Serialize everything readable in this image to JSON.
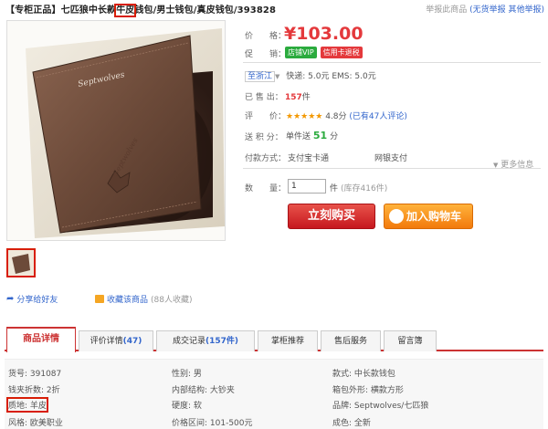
{
  "header": {
    "title_pre": "【专柜正品】七匹狼中长款",
    "title_hl": "牛皮",
    "title_post": "钱包/男士钱包/真皮钱包/393828",
    "report_prefix": "举报此商品",
    "no_fake_report": "(无货举报",
    "other_report": "其他举报)"
  },
  "info": {
    "price_label": "价　　格：",
    "price": "¥103.00",
    "promo_label": "促　　销：",
    "promo_badges": [
      "店铺VIP",
      "信用卡退税"
    ],
    "ship_from": "至浙江",
    "ship_text": "快递: 5.0元  EMS: 5.0元",
    "sold_label": "已 售 出：",
    "sold_count": "157",
    "sold_unit": "件",
    "rating_label": "评　　价：",
    "stars": "★★★★★",
    "rating_score": "4.8分",
    "rating_reviews": "(已有47人评论)",
    "points_label": "送 积 分：",
    "points_prefix": "单件送",
    "points_value": "51",
    "points_unit": "分",
    "pay_label": "付款方式：",
    "pay_methods": [
      "支付宝卡通",
      "网银支付"
    ],
    "more_info": "更多信息",
    "qty_label": "数　　量：",
    "qty_value": "1",
    "qty_unit": "件",
    "stock": "(库存416件)",
    "buy_now": "立刻购买",
    "add_cart": "加入购物车"
  },
  "media": {
    "share": "分享给好友",
    "fav": "收藏该商品",
    "fav_count": "(88人收藏)"
  },
  "tabs": [
    {
      "label": "商品详情",
      "num": ""
    },
    {
      "label": "评价详情",
      "num": "(47)"
    },
    {
      "label": "成交记录",
      "num": "(157件)"
    },
    {
      "label": "掌柜推荐",
      "num": ""
    },
    {
      "label": "售后服务",
      "num": ""
    },
    {
      "label": "留言簿",
      "num": ""
    }
  ],
  "attributes": {
    "col1": [
      "货号: 391087",
      "钱夹折数: 2折",
      "质地: 羊皮",
      "风格: 欧美职业"
    ],
    "col2": [
      "性别: 男",
      "内部结构: 大钞夹",
      "硬度: 软",
      "价格区间: 101-500元"
    ],
    "col3": [
      "款式: 中长款钱包",
      "箱包外形: 横款方形",
      "品牌: Septwolves/七匹狼",
      "成色: 全新"
    ]
  },
  "colors": {
    "accent_red": "#e4393c",
    "buy_red": "#c6171e",
    "cart_orange": "#f27a0c",
    "link_blue": "#3366cc"
  }
}
